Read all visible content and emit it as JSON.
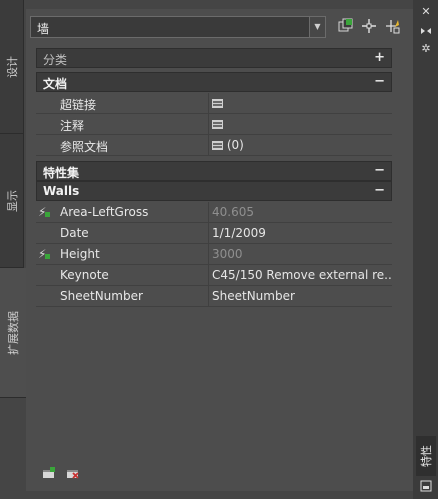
{
  "left_tabs": [
    {
      "label": "设计"
    },
    {
      "label": "显示"
    },
    {
      "label": "扩展数据"
    }
  ],
  "selector": {
    "value": "墙"
  },
  "sections": {
    "category": {
      "title": "分类",
      "toggle": "+"
    },
    "document": {
      "title": "文档",
      "toggle": "−"
    },
    "property_sets": {
      "title": "特性集",
      "toggle": "−"
    },
    "walls": {
      "title": "Walls",
      "toggle": "−"
    }
  },
  "document_rows": [
    {
      "label": "超链接",
      "value": ""
    },
    {
      "label": "注释",
      "value": ""
    },
    {
      "label": "参照文档",
      "value": "(0)"
    }
  ],
  "walls_rows": [
    {
      "label": "Area-LeftGross",
      "value": "40.605",
      "auto": true
    },
    {
      "label": "Date",
      "value": "1/1/2009",
      "auto": false
    },
    {
      "label": "Height",
      "value": "3000",
      "auto": true
    },
    {
      "label": "Keynote",
      "value": "C45/150 Remove external re...",
      "auto": false
    },
    {
      "label": "SheetNumber",
      "value": "SheetNumber",
      "auto": false
    }
  ],
  "right_strip": {
    "label": "特性"
  },
  "colors": {
    "panel": "#4d4d4d",
    "header": "#3b3b3b",
    "dim_text": "#8f8f8f",
    "accent_green": "#3aa53a",
    "accent_red": "#c83232"
  }
}
